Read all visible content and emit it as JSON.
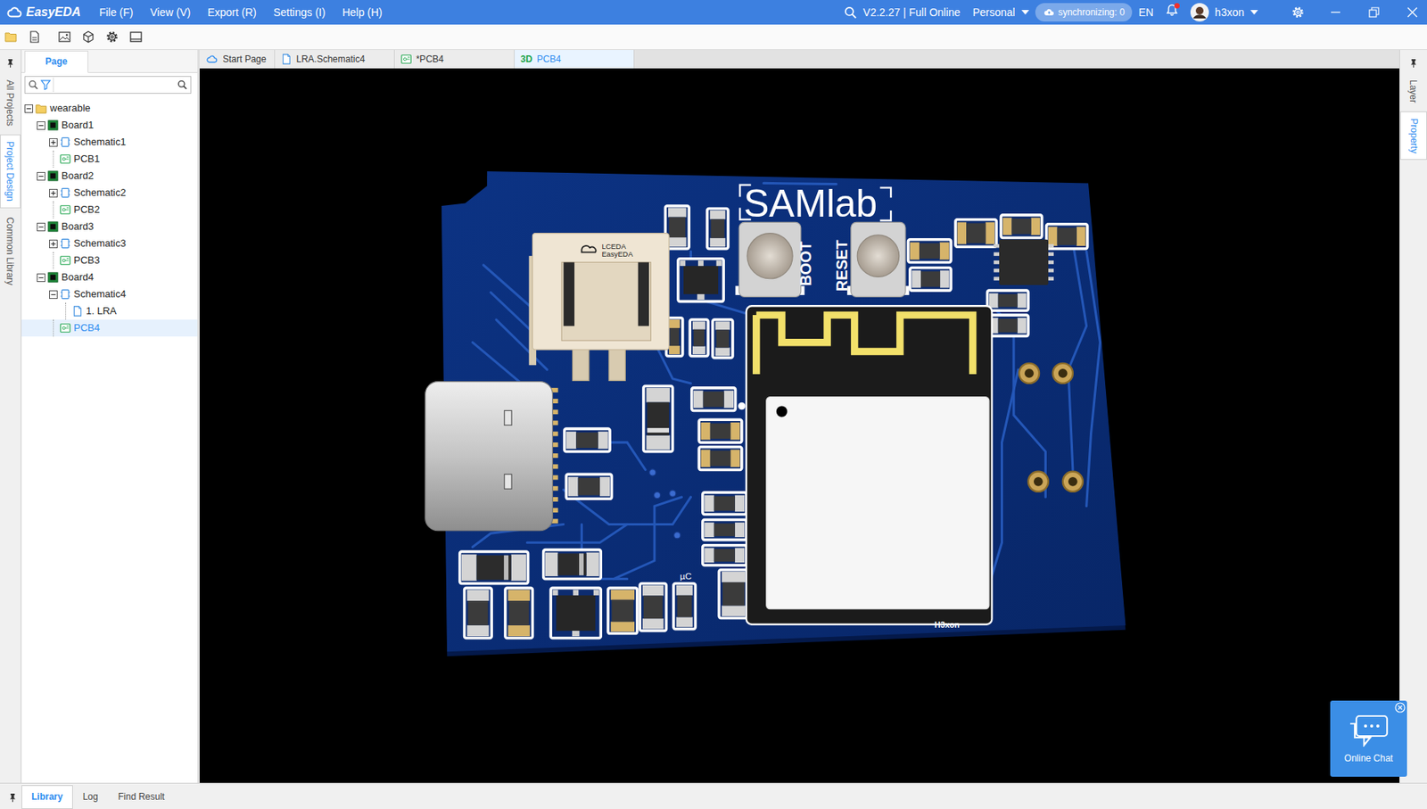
{
  "app": {
    "logo": "EasyEDA",
    "version": "V2.2.27 | Full Online",
    "plan": "Personal",
    "sync_status": "synchronizing: 0",
    "language": "EN",
    "user": "h3xon",
    "has_notification": true
  },
  "menu": [
    "File (F)",
    "View (V)",
    "Export (R)",
    "Settings (I)",
    "Help (H)"
  ],
  "side_tabs": [
    {
      "label": "All Projects",
      "selected": false
    },
    {
      "label": "Project Design",
      "selected": true
    },
    {
      "label": "Common Library",
      "selected": false
    }
  ],
  "panel": {
    "tab": {
      "label": "Page",
      "selected": true
    }
  },
  "tree": [
    {
      "label": "wearable",
      "kind": "folder",
      "depth": 0,
      "expandable": true,
      "expanded": true,
      "selected": false
    },
    {
      "label": "Board1",
      "kind": "board",
      "depth": 1,
      "expandable": true,
      "expanded": true,
      "selected": false
    },
    {
      "label": "Schematic1",
      "kind": "schematic",
      "depth": 2,
      "expandable": true,
      "expanded": false,
      "selected": false
    },
    {
      "label": "PCB1",
      "kind": "pcb",
      "depth": 2,
      "expandable": false,
      "expanded": false,
      "selected": false
    },
    {
      "label": "Board2",
      "kind": "board",
      "depth": 1,
      "expandable": true,
      "expanded": true,
      "selected": false
    },
    {
      "label": "Schematic2",
      "kind": "schematic",
      "depth": 2,
      "expandable": true,
      "expanded": false,
      "selected": false
    },
    {
      "label": "PCB2",
      "kind": "pcb",
      "depth": 2,
      "expandable": false,
      "expanded": false,
      "selected": false
    },
    {
      "label": "Board3",
      "kind": "board",
      "depth": 1,
      "expandable": true,
      "expanded": true,
      "selected": false
    },
    {
      "label": "Schematic3",
      "kind": "schematic",
      "depth": 2,
      "expandable": true,
      "expanded": false,
      "selected": false
    },
    {
      "label": "PCB3",
      "kind": "pcb",
      "depth": 2,
      "expandable": false,
      "expanded": false,
      "selected": false
    },
    {
      "label": "Board4",
      "kind": "board",
      "depth": 1,
      "expandable": true,
      "expanded": true,
      "selected": false
    },
    {
      "label": "Schematic4",
      "kind": "schematic",
      "depth": 2,
      "expandable": true,
      "expanded": true,
      "selected": false
    },
    {
      "label": "1. LRA",
      "kind": "sheet",
      "depth": 3,
      "expandable": false,
      "expanded": false,
      "selected": false
    },
    {
      "label": "PCB4",
      "kind": "pcb",
      "depth": 2,
      "expandable": false,
      "expanded": false,
      "selected": true
    }
  ],
  "doc_tabs": [
    {
      "label": "Start Page",
      "kind": "start",
      "selected": false
    },
    {
      "label": "LRA.Schematic4",
      "kind": "schematic",
      "selected": false
    },
    {
      "label": "*PCB4",
      "kind": "pcb",
      "selected": false
    },
    {
      "badge": "3D",
      "label": "PCB4",
      "kind": "view3d",
      "selected": true
    }
  ],
  "right_tabs": [
    {
      "label": "Layer",
      "selected": false
    },
    {
      "label": "Property",
      "selected": true
    }
  ],
  "board": {
    "title": "SAMlab",
    "boot": "BOOT",
    "reset": "RESET",
    "signature": "H3xon",
    "connector_brand": [
      "LCEDA",
      "EasyEDA"
    ],
    "mcu_label": "µC"
  },
  "bottom_tabs": [
    {
      "label": "Library",
      "selected": true
    },
    {
      "label": "Log",
      "selected": false
    },
    {
      "label": "Find Result",
      "selected": false
    }
  ],
  "chat": {
    "label": "Online Chat"
  }
}
